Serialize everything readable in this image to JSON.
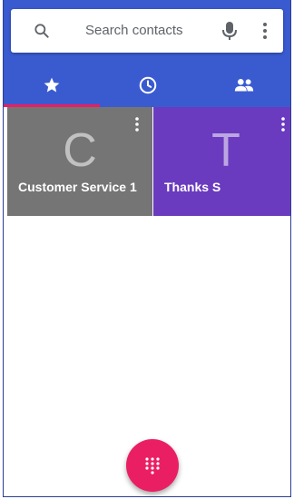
{
  "search": {
    "placeholder": "Search contacts",
    "search_icon": "search-icon",
    "mic_icon": "mic-icon",
    "more_icon": "more-vert-icon"
  },
  "tabs": [
    {
      "icon": "star-icon",
      "selected": true
    },
    {
      "icon": "clock-icon",
      "selected": false
    },
    {
      "icon": "people-icon",
      "selected": false
    }
  ],
  "favorites": [
    {
      "letter": "C",
      "name": "Customer Service 1",
      "color": "#757575"
    },
    {
      "letter": "T",
      "name": "Thanks S",
      "color": "#6a3bbf"
    }
  ],
  "fab": {
    "icon": "dialpad-icon"
  },
  "colors": {
    "header": "#3a5bd0",
    "accent": "#e91e63",
    "fab": "#ea1f63"
  }
}
